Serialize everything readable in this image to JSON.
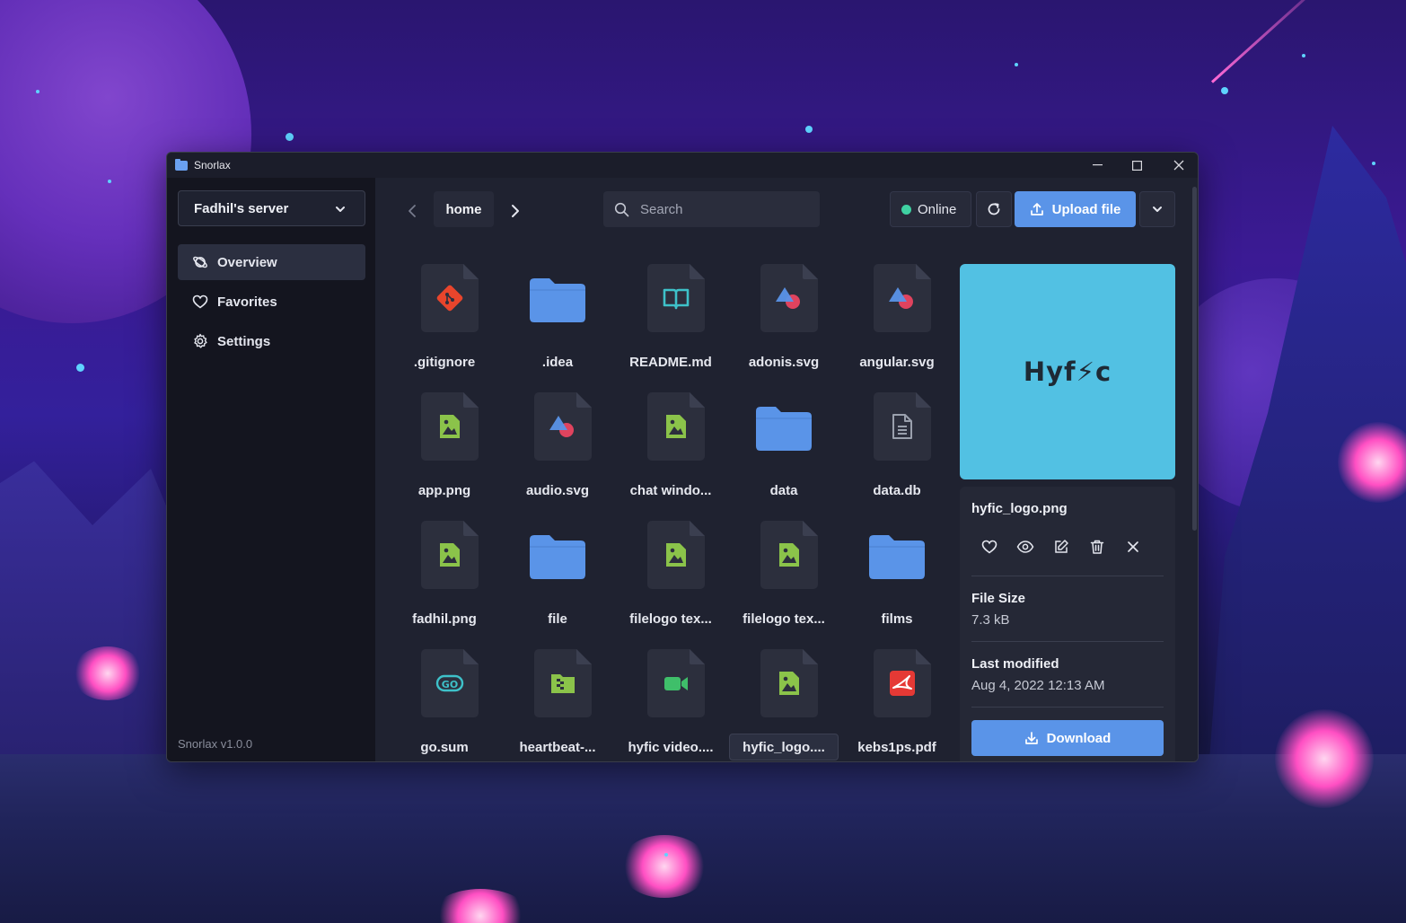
{
  "window": {
    "title": "Snorlax"
  },
  "sidebar": {
    "server": "Fadhil's server",
    "items": [
      {
        "label": "Overview",
        "icon": "planet-icon",
        "active": true
      },
      {
        "label": "Favorites",
        "icon": "heart-icon",
        "active": false
      },
      {
        "label": "Settings",
        "icon": "gear-icon",
        "active": false
      }
    ],
    "version": "Snorlax v1.0.0"
  },
  "toolbar": {
    "breadcrumb": "home",
    "search_placeholder": "Search",
    "status": "Online",
    "status_color": "#3fd1a2",
    "upload_label": "Upload file",
    "accent": "#5a94e8"
  },
  "files": [
    {
      "name": ".gitignore",
      "icon": "git-icon",
      "color": "#e8452c"
    },
    {
      "name": ".idea",
      "icon": "folder-icon",
      "color": "#5a94e8"
    },
    {
      "name": "README.md",
      "icon": "book-icon",
      "color": "#3ec1c9"
    },
    {
      "name": "adonis.svg",
      "icon": "svg-shapes-icon",
      "color": "#5a94e8"
    },
    {
      "name": "angular.svg",
      "icon": "svg-shapes-icon",
      "color": "#5a94e8"
    },
    {
      "name": "app.png",
      "icon": "image-icon",
      "color": "#8bc34a"
    },
    {
      "name": "audio.svg",
      "icon": "svg-shapes-icon",
      "color": "#5a94e8"
    },
    {
      "name": "chat windo...",
      "icon": "image-icon",
      "color": "#8bc34a"
    },
    {
      "name": "data",
      "icon": "folder-icon",
      "color": "#5a94e8"
    },
    {
      "name": "data.db",
      "icon": "document-icon",
      "color": "#9aa0ad"
    },
    {
      "name": "fadhil.png",
      "icon": "image-icon",
      "color": "#8bc34a"
    },
    {
      "name": "file",
      "icon": "folder-icon",
      "color": "#5a94e8"
    },
    {
      "name": "filelogo tex...",
      "icon": "image-icon",
      "color": "#8bc34a"
    },
    {
      "name": "filelogo tex...",
      "icon": "image-icon",
      "color": "#8bc34a"
    },
    {
      "name": "films",
      "icon": "folder-icon",
      "color": "#5a94e8"
    },
    {
      "name": "go.sum",
      "icon": "go-icon",
      "color": "#3ec1c9"
    },
    {
      "name": "heartbeat-...",
      "icon": "archive-icon",
      "color": "#8bc34a"
    },
    {
      "name": "hyfic video....",
      "icon": "video-icon",
      "color": "#3fbf6a"
    },
    {
      "name": "hyfic_logo....",
      "icon": "image-icon",
      "color": "#8bc34a",
      "selected": true
    },
    {
      "name": "kebs1ps.pdf",
      "icon": "pdf-icon",
      "color": "#e53935"
    }
  ],
  "details": {
    "preview_text": "Hyf⚡c",
    "preview_color": "#52c1e3",
    "name": "hyfic_logo.png",
    "file_size_label": "File Size",
    "file_size": "7.3 kB",
    "modified_label": "Last modified",
    "modified": "Aug 4, 2022 12:13 AM",
    "download_label": "Download"
  }
}
